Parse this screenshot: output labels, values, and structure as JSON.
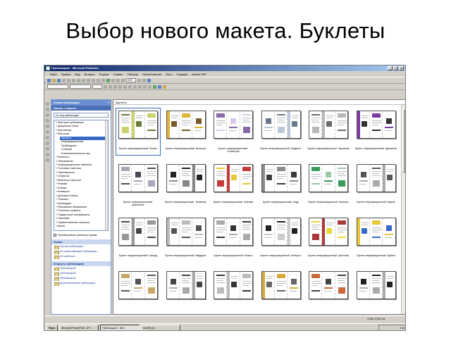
{
  "slide": {
    "title": "Выбор нового макета. Буклеты"
  },
  "window": {
    "title": "Публикация2 - Microsoft Publisher",
    "btn_min": "_",
    "btn_max": "□",
    "btn_close": "×"
  },
  "menu": [
    "Файл",
    "Правка",
    "Вид",
    "Вставка",
    "Формат",
    "Сервис",
    "Таблица",
    "Расположение",
    "Окно",
    "Справка",
    "Adobe PDF"
  ],
  "toolbar": {
    "zoom": "44%"
  },
  "taskpane": {
    "header": "Новая публикация",
    "close": "×",
    "section_title": "Начать с макета",
    "select_value": "По типу публикации",
    "tree": [
      {
        "label": "Быстрые публикации",
        "level": 0
      },
      {
        "label": "Документы Word",
        "level": 0
      },
      {
        "label": "Бюллетени",
        "level": 0
      },
      {
        "label": "Веб-узлы",
        "level": 0
      },
      {
        "label": "Буклеты",
        "level": 1,
        "selected": true
      },
      {
        "label": "Информационные",
        "level": 1
      },
      {
        "label": "Прейскурант",
        "level": 1
      },
      {
        "label": "События",
        "level": 1
      },
      {
        "label": "Благотворительные акц",
        "level": 1
      },
      {
        "label": "Каталоги",
        "level": 0
      },
      {
        "label": "Объявления",
        "level": 0
      },
      {
        "label": "Информационные таблички",
        "level": 0
      },
      {
        "label": "Почтовые карточки",
        "level": 0
      },
      {
        "label": "Приглашения",
        "level": 0
      },
      {
        "label": "Открытки",
        "level": 0
      },
      {
        "label": "Визитные карточки",
        "level": 0
      },
      {
        "label": "Резюме",
        "level": 0
      },
      {
        "label": "Бланки",
        "level": 0
      },
      {
        "label": "Конверты",
        "level": 0
      },
      {
        "label": "Деловые бланки",
        "level": 0
      },
      {
        "label": "Плакаты",
        "level": 0
      },
      {
        "label": "Календари",
        "level": 0
      },
      {
        "label": "Рекламные объявления",
        "level": 0
      },
      {
        "label": "Почетные грамоты",
        "level": 0
      },
      {
        "label": "Подарочные сертификаты",
        "level": 0
      },
      {
        "label": "Наклейки",
        "level": 0
      },
      {
        "label": "Приветственные открытки",
        "level": 0
      },
      {
        "label": "Меню",
        "level": 0
      }
    ],
    "checkbox_label": "Преобразовать разметку справа",
    "new_section": "Новая",
    "new_links": [
      "Пустая публикация",
      "Из существующей публикации...",
      "Из шаблона..."
    ],
    "open_section": "Открыть публикацию",
    "open_links": [
      "Публикация2",
      "Публикация3",
      "Публикация1",
      "Дополнительные публикации..."
    ]
  },
  "gallery": {
    "header": "Буклеты",
    "items": [
      {
        "caption": "Буклет информационный. Волны",
        "a": "#c9d36a",
        "b": "#6b7a3a",
        "selected": true
      },
      {
        "caption": "Буклет информационный. Выносок",
        "a": "#e2b43a",
        "b": "#7a5a2a"
      },
      {
        "caption": "Буклет информационный. Геометрия",
        "a": "#8a6aa8",
        "b": "#d8c8e8"
      },
      {
        "caption": "Буклет информационный. Градиент",
        "a": "#b8c8d8",
        "b": "#6a7a8a"
      },
      {
        "caption": "Буклет информационный. Гармония",
        "a": "#b8b8b8",
        "b": "#6a6a6a"
      },
      {
        "caption": "Буклет информационный. Движение",
        "a": "#7a3aa8",
        "b": "#333333"
      },
      {
        "caption": "Буклет информационный. Диагональ",
        "a": "#a8a8b8",
        "b": "#4a4a5a"
      },
      {
        "caption": "Буклет информационный. Затмение",
        "a": "#888888",
        "b": "#222222"
      },
      {
        "caption": "Буклет информационный. Зубчики",
        "a": "#c83a3a",
        "b": "#e8c83a"
      },
      {
        "caption": "Буклет информационный. Кадр",
        "a": "#8a8a8a",
        "b": "#3a3a3a"
      },
      {
        "caption": "Буклет информационный. Капсулы",
        "a": "#3a9a5a",
        "b": "#9ac8a8"
      },
      {
        "caption": "Буклет информационный. Каркас",
        "a": "#aaaaaa",
        "b": "#555555"
      },
      {
        "caption": "Буклет информационный. Каскад",
        "a": "#999999",
        "b": "#444444"
      },
      {
        "caption": "Буклет информационный. Квадрант",
        "a": "#bbbbbb",
        "b": "#555555"
      },
      {
        "caption": "Буклет информационный. Кляксы",
        "a": "#aaaaaa",
        "b": "#333333"
      },
      {
        "caption": "Буклет информационный. Контраст",
        "a": "#cccccc",
        "b": "#222222"
      },
      {
        "caption": "Буклет информационный. Крестики",
        "a": "#a83a3a",
        "b": "#e8d83a"
      },
      {
        "caption": "Буклет информационный. Кубики",
        "a": "#e8c83a",
        "b": "#3a6ac8"
      },
      {
        "caption": "",
        "a": "#c8a86a",
        "b": "#555555"
      },
      {
        "caption": "",
        "a": "#aaaaaa",
        "b": "#444444"
      },
      {
        "caption": "",
        "a": "#bbbbbb",
        "b": "#333333"
      },
      {
        "caption": "",
        "a": "#d8a83a",
        "b": "#666666"
      },
      {
        "caption": "",
        "a": "#c86a3a",
        "b": "#444444"
      },
      {
        "caption": "",
        "a": "#aaaaaa",
        "b": "#222222"
      }
    ]
  },
  "statusbar": {
    "coords": "5,066; 5,500 см."
  },
  "taskbar": {
    "start": "Пуск",
    "tasks": [
      {
        "label": "Microsoft PowerPoint - [Pr...",
        "active": false
      },
      {
        "label": "Публикация2 - Micr...",
        "active": true
      },
      {
        "label": "Intel(R) [1]",
        "active": false
      }
    ],
    "clock": "0:18"
  }
}
